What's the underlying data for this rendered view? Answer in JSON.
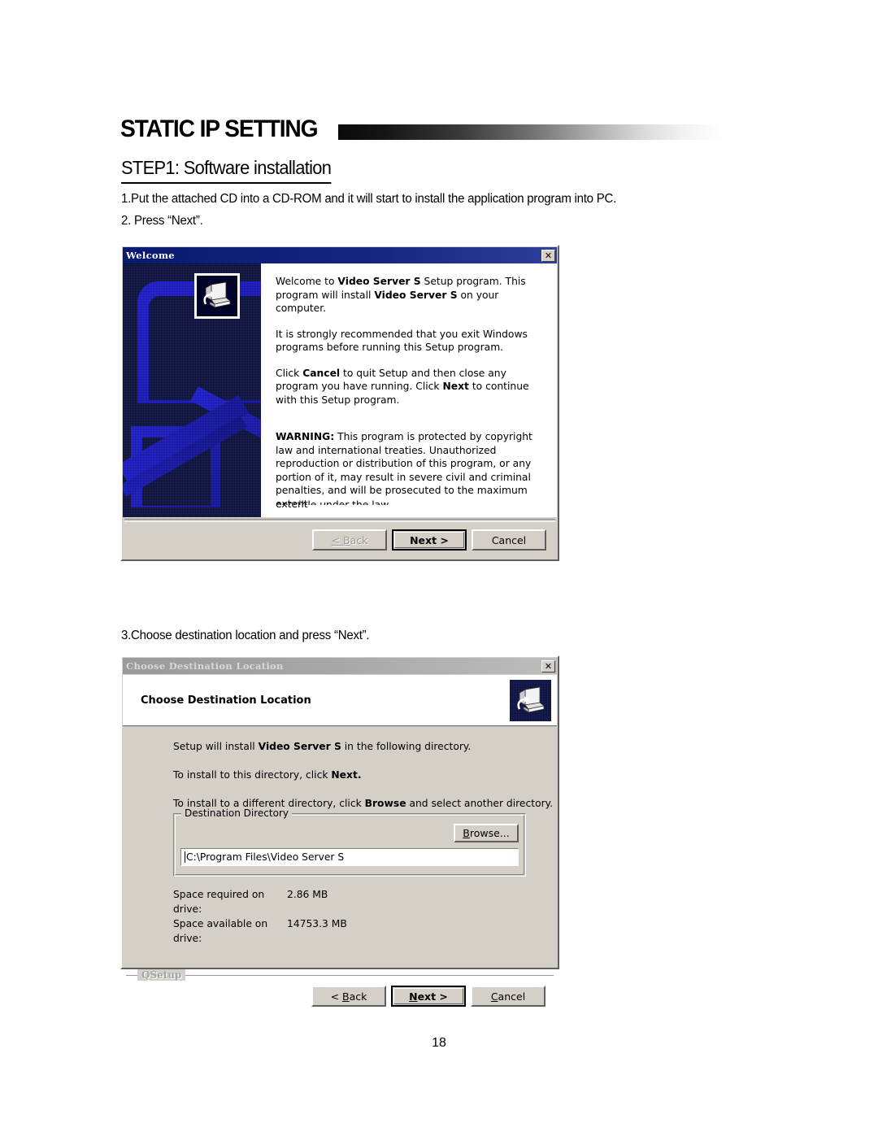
{
  "page": {
    "doc_title": "STATIC IP SETTING",
    "step_heading": "STEP1: Software installation",
    "para_1": "1.Put the attached CD into a CD-ROM and it will start to install the application program into PC.",
    "para_2": "2. Press “Next”.",
    "para_3": "3.Choose destination location and press “Next”.",
    "page_number": "18"
  },
  "welcome_dialog": {
    "title": "Welcome",
    "close_label": "✕",
    "paragraph_1_a": "Welcome to ",
    "paragraph_1_b": "Video Server S",
    "paragraph_1_c": " Setup program. This program will install ",
    "paragraph_1_d": "Video Server S",
    "paragraph_1_e": " on your computer.",
    "paragraph_2": "It is strongly recommended that you exit Windows programs before running this Setup program.",
    "paragraph_3_a": "Click ",
    "paragraph_3_b": "Cancel",
    "paragraph_3_c": " to quit Setup and then close any program you have running. Click ",
    "paragraph_3_d": "Next",
    "paragraph_3_e": " to continue with this Setup program.",
    "warning_label": "WARNING:",
    "warning_text": " This program is protected by copyright law and international treaties. Unauthorized reproduction or distribution of this program, or any portion of it, may result in severe civil and criminal penalties, and will be prosecuted to the maximum extent",
    "warning_clipped": "possible under the law.",
    "back_label": "< Back",
    "next_label": "Next >",
    "cancel_label": "Cancel"
  },
  "destination_dialog": {
    "title": "Choose Destination Location",
    "close_label": "✕",
    "header_title": "Choose Destination Location",
    "line_1_a": "Setup will install ",
    "line_1_b": "Video Server S",
    "line_1_c": " in the following directory.",
    "line_2_a": "To install to this directory, click ",
    "line_2_b": "Next.",
    "line_3_a": "To install to a different directory, click ",
    "line_3_b": "Browse",
    "line_3_c": " and select another directory.",
    "group_legend": "Destination Directory",
    "browse_label": "Browse...",
    "path_value": "C:\\Program Files\\Video Server S",
    "space_required_label": "Space required on drive:",
    "space_required_value": "2.86 MB",
    "space_available_label": "Space available on drive:",
    "space_available_value": "14753.3 MB",
    "qsetup_label": "QSetup",
    "back_label": "< Back",
    "next_label": "Next >",
    "cancel_label": "Cancel"
  }
}
